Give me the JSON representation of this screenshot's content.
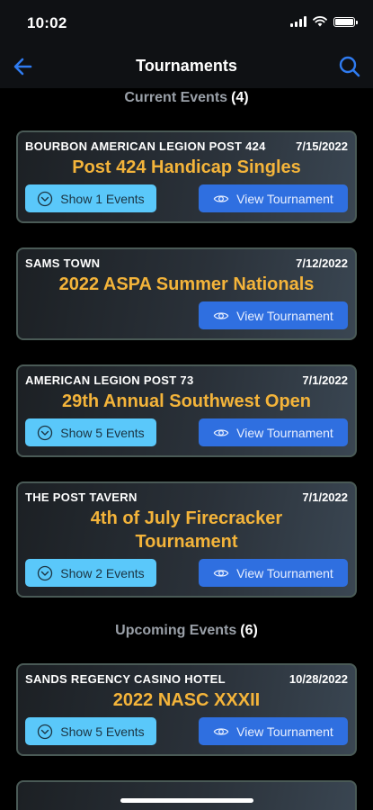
{
  "status_bar": {
    "time": "10:02"
  },
  "nav": {
    "title": "Tournaments",
    "back_icon": "back-arrow-icon",
    "search_icon": "search-icon"
  },
  "colors": {
    "accent_blue": "#2f6fe0",
    "show_button": "#5ac8fa",
    "title_gold": "#f4b43a"
  },
  "sections": {
    "current": {
      "label": "Current Events",
      "count": "(4)"
    },
    "upcoming": {
      "label": "Upcoming Events",
      "count": "(6)"
    }
  },
  "cards": [
    {
      "venue": "BOURBON AMERICAN LEGION POST 424",
      "date": "7/15/2022",
      "name": "Post 424 Handicap Singles",
      "show_label": "Show 1 Events",
      "view_label": "View Tournament"
    },
    {
      "venue": "SAMS TOWN",
      "date": "7/12/2022",
      "name": "2022 ASPA Summer Nationals",
      "view_label": "View Tournament"
    },
    {
      "venue": "AMERICAN LEGION POST 73",
      "date": "7/1/2022",
      "name": "29th Annual Southwest Open",
      "show_label": "Show 5 Events",
      "view_label": "View Tournament"
    },
    {
      "venue": "THE POST TAVERN",
      "date": "7/1/2022",
      "name": "4th of July Firecracker Tournament",
      "show_label": "Show 2 Events",
      "view_label": "View Tournament"
    },
    {
      "venue": "SANDS REGENCY CASINO HOTEL",
      "date": "10/28/2022",
      "name": "2022 NASC XXXII",
      "show_label": "Show 5 Events",
      "view_label": "View Tournament"
    }
  ]
}
